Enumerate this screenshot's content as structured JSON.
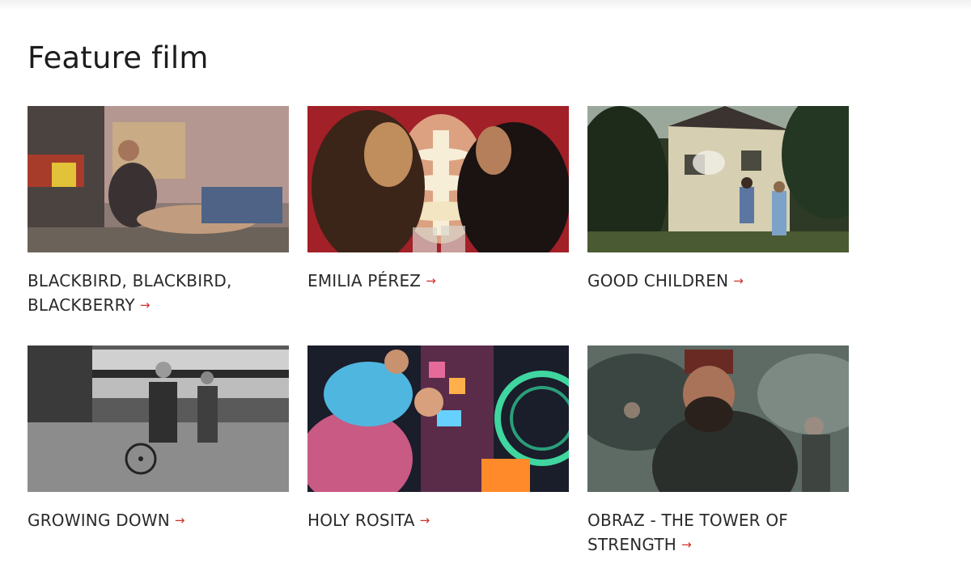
{
  "page": {
    "title": "Feature film"
  },
  "films": [
    {
      "title": "BLACKBIRD, BLACKBIRD, BLACKBERRY",
      "arrow": "→",
      "thumb_icon": "film-still-image"
    },
    {
      "title": "EMILIA PÉREZ",
      "arrow": "→",
      "thumb_icon": "film-still-image"
    },
    {
      "title": "GOOD CHILDREN",
      "arrow": "→",
      "thumb_icon": "film-still-image"
    },
    {
      "title": "GROWING DOWN",
      "arrow": "→",
      "thumb_icon": "film-still-image"
    },
    {
      "title": "HOLY ROSITA",
      "arrow": "→",
      "thumb_icon": "film-still-image"
    },
    {
      "title": "OBRAZ - THE TOWER OF STRENGTH",
      "arrow": "→",
      "thumb_icon": "film-still-image"
    }
  ],
  "colors": {
    "accent": "#d0312d",
    "text": "#2a2a2a"
  }
}
